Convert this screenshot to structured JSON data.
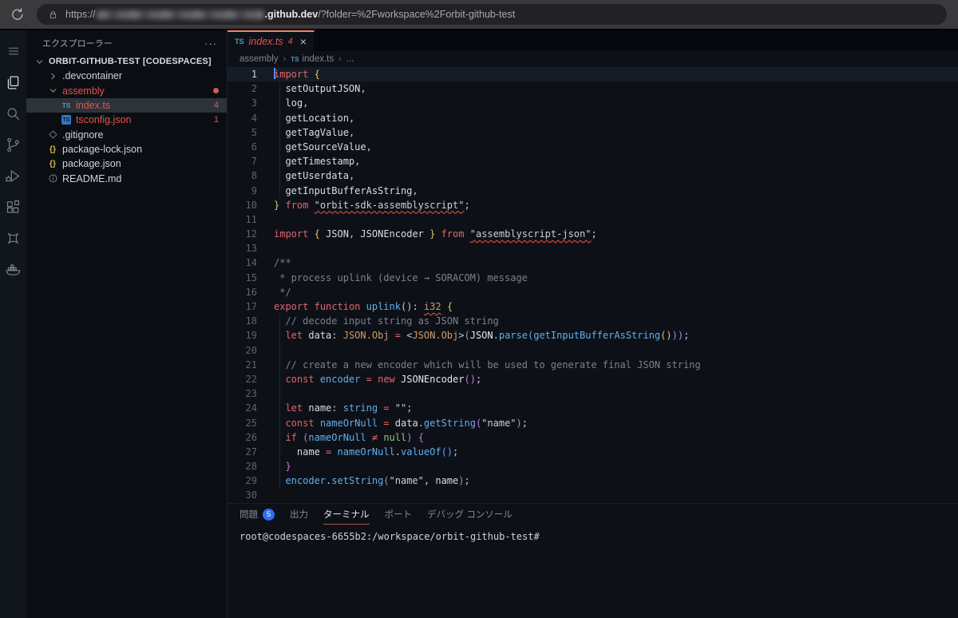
{
  "browser": {
    "url_scheme": "https://",
    "url_domain": ".github.dev",
    "url_path": "/?folder=%2Fworkspace%2Forbit-github-test"
  },
  "activity_bar": {
    "items": [
      {
        "name": "menu",
        "icon": "menu"
      },
      {
        "name": "explorer",
        "icon": "files",
        "active": true
      },
      {
        "name": "search",
        "icon": "search"
      },
      {
        "name": "source-control",
        "icon": "branch"
      },
      {
        "name": "run-debug",
        "icon": "debug"
      },
      {
        "name": "extensions",
        "icon": "extensions"
      },
      {
        "name": "codespaces",
        "icon": "codespaces"
      },
      {
        "name": "docker",
        "icon": "docker"
      }
    ]
  },
  "explorer": {
    "title": "エクスプローラー",
    "menu_icon": "···",
    "rows": [
      {
        "label": "ORBIT-GITHUB-TEST [CODESPACES]",
        "depth": 0,
        "chevron": "down",
        "bold": true
      },
      {
        "label": ".devcontainer",
        "depth": 1,
        "chevron": "right"
      },
      {
        "label": "assembly",
        "depth": 1,
        "chevron": "down",
        "error": true,
        "dot": true
      },
      {
        "label": "index.ts",
        "depth": 2,
        "icon": "ts",
        "error": true,
        "badge": "4",
        "selected": true
      },
      {
        "label": "tsconfig.json",
        "depth": 2,
        "icon": "tsbox",
        "error": true,
        "badge": "1"
      },
      {
        "label": ".gitignore",
        "depth": 1,
        "icon": "diamond"
      },
      {
        "label": "package-lock.json",
        "depth": 1,
        "icon": "braces"
      },
      {
        "label": "package.json",
        "depth": 1,
        "icon": "braces"
      },
      {
        "label": "README.md",
        "depth": 1,
        "icon": "info"
      }
    ]
  },
  "tabs": [
    {
      "icon_text": "TS",
      "label": "index.ts",
      "badge": "4",
      "close": "×",
      "active": true
    }
  ],
  "breadcrumbs": [
    {
      "label": "assembly"
    },
    {
      "label": "index.ts",
      "icon": "ts"
    },
    {
      "label": "..."
    }
  ],
  "editor": {
    "indent_guides": [
      [
        2,
        9
      ],
      [
        18,
        29
      ]
    ],
    "lines": [
      {
        "n": 1,
        "current": true,
        "cursor": true,
        "t": [
          [
            "kw",
            "import"
          ],
          [
            "p",
            " "
          ],
          [
            "b1",
            "{"
          ]
        ]
      },
      {
        "n": 2,
        "t": [
          [
            "p",
            "  "
          ],
          [
            "v",
            "setOutputJSON"
          ],
          [
            "p",
            ","
          ]
        ]
      },
      {
        "n": 3,
        "t": [
          [
            "p",
            "  "
          ],
          [
            "v",
            "log"
          ],
          [
            "p",
            ","
          ]
        ]
      },
      {
        "n": 4,
        "t": [
          [
            "p",
            "  "
          ],
          [
            "v",
            "getLocation"
          ],
          [
            "p",
            ","
          ]
        ]
      },
      {
        "n": 5,
        "t": [
          [
            "p",
            "  "
          ],
          [
            "v",
            "getTagValue"
          ],
          [
            "p",
            ","
          ]
        ]
      },
      {
        "n": 6,
        "t": [
          [
            "p",
            "  "
          ],
          [
            "v",
            "getSourceValue"
          ],
          [
            "p",
            ","
          ]
        ]
      },
      {
        "n": 7,
        "t": [
          [
            "p",
            "  "
          ],
          [
            "v",
            "getTimestamp"
          ],
          [
            "p",
            ","
          ]
        ]
      },
      {
        "n": 8,
        "t": [
          [
            "p",
            "  "
          ],
          [
            "v",
            "getUserdata"
          ],
          [
            "p",
            ","
          ]
        ]
      },
      {
        "n": 9,
        "t": [
          [
            "p",
            "  "
          ],
          [
            "v",
            "getInputBufferAsString"
          ],
          [
            "p",
            ","
          ]
        ]
      },
      {
        "n": 10,
        "t": [
          [
            "b1",
            "}"
          ],
          [
            "p",
            " "
          ],
          [
            "kw",
            "from"
          ],
          [
            "p",
            " "
          ],
          [
            "strE",
            "\"orbit-sdk-assemblyscript\""
          ],
          [
            "p",
            ";"
          ]
        ]
      },
      {
        "n": 11,
        "t": []
      },
      {
        "n": 12,
        "t": [
          [
            "kw",
            "import"
          ],
          [
            "p",
            " "
          ],
          [
            "b1",
            "{"
          ],
          [
            "p",
            " "
          ],
          [
            "v",
            "JSON"
          ],
          [
            "p",
            ", "
          ],
          [
            "v",
            "JSONEncoder"
          ],
          [
            "p",
            " "
          ],
          [
            "b1",
            "}"
          ],
          [
            "p",
            " "
          ],
          [
            "kw",
            "from"
          ],
          [
            "p",
            " "
          ],
          [
            "strE",
            "\"assemblyscript-json\""
          ],
          [
            "p",
            ";"
          ]
        ]
      },
      {
        "n": 13,
        "t": []
      },
      {
        "n": 14,
        "t": [
          [
            "cm",
            "/**"
          ]
        ]
      },
      {
        "n": 15,
        "t": [
          [
            "cm",
            " * process uplink (device → SORACOM) message"
          ]
        ]
      },
      {
        "n": 16,
        "t": [
          [
            "cm",
            " */"
          ]
        ]
      },
      {
        "n": 17,
        "t": [
          [
            "kw",
            "export"
          ],
          [
            "p",
            " "
          ],
          [
            "kw",
            "function"
          ],
          [
            "p",
            " "
          ],
          [
            "fn",
            "uplink"
          ],
          [
            "p",
            "()"
          ],
          [
            "p",
            ": "
          ],
          [
            "typE",
            "i32"
          ],
          [
            "p",
            " "
          ],
          [
            "b1",
            "{"
          ]
        ]
      },
      {
        "n": 18,
        "t": [
          [
            "p",
            "  "
          ],
          [
            "cm",
            "// decode input string as JSON string"
          ]
        ]
      },
      {
        "n": 19,
        "t": [
          [
            "p",
            "  "
          ],
          [
            "kw",
            "let"
          ],
          [
            "p",
            " "
          ],
          [
            "v",
            "data"
          ],
          [
            "p",
            ": "
          ],
          [
            "typ",
            "JSON.Obj"
          ],
          [
            "p",
            " "
          ],
          [
            "op",
            "="
          ],
          [
            "p",
            " <"
          ],
          [
            "typ",
            "JSON.Obj"
          ],
          [
            "p",
            ">"
          ],
          [
            "b2",
            "("
          ],
          [
            "wt",
            "JSON"
          ],
          [
            "p",
            "."
          ],
          [
            "fn",
            "parse"
          ],
          [
            "b3",
            "("
          ],
          [
            "fn",
            "getInputBufferAsString"
          ],
          [
            "b1",
            "()"
          ],
          [
            "b3",
            ")"
          ],
          [
            "b2",
            ")"
          ],
          [
            "p",
            ";"
          ]
        ]
      },
      {
        "n": 20,
        "t": []
      },
      {
        "n": 21,
        "t": [
          [
            "p",
            "  "
          ],
          [
            "cm",
            "// create a new encoder which will be used to generate final JSON string"
          ]
        ]
      },
      {
        "n": 22,
        "t": [
          [
            "p",
            "  "
          ],
          [
            "kw",
            "const"
          ],
          [
            "p",
            " "
          ],
          [
            "fn",
            "encoder"
          ],
          [
            "p",
            " "
          ],
          [
            "op",
            "="
          ],
          [
            "p",
            " "
          ],
          [
            "kw",
            "new"
          ],
          [
            "p",
            " "
          ],
          [
            "wt",
            "JSONEncoder"
          ],
          [
            "b2",
            "()"
          ],
          [
            "p",
            ";"
          ]
        ]
      },
      {
        "n": 23,
        "t": []
      },
      {
        "n": 24,
        "t": [
          [
            "p",
            "  "
          ],
          [
            "kw",
            "let"
          ],
          [
            "p",
            " "
          ],
          [
            "v",
            "name"
          ],
          [
            "p",
            ": "
          ],
          [
            "fn",
            "string"
          ],
          [
            "p",
            " "
          ],
          [
            "op",
            "="
          ],
          [
            "p",
            " "
          ],
          [
            "str",
            "\"\""
          ],
          [
            "p",
            ";"
          ]
        ]
      },
      {
        "n": 25,
        "t": [
          [
            "p",
            "  "
          ],
          [
            "kw",
            "const"
          ],
          [
            "p",
            " "
          ],
          [
            "fn",
            "nameOrNull"
          ],
          [
            "p",
            " "
          ],
          [
            "op",
            "="
          ],
          [
            "p",
            " "
          ],
          [
            "v",
            "data"
          ],
          [
            "p",
            "."
          ],
          [
            "fn",
            "getString"
          ],
          [
            "b2",
            "("
          ],
          [
            "str",
            "\"name\""
          ],
          [
            "b2",
            ")"
          ],
          [
            "p",
            ";"
          ]
        ]
      },
      {
        "n": 26,
        "t": [
          [
            "p",
            "  "
          ],
          [
            "kw",
            "if"
          ],
          [
            "p",
            " "
          ],
          [
            "b2",
            "("
          ],
          [
            "fn",
            "nameOrNull"
          ],
          [
            "p",
            " "
          ],
          [
            "op",
            "≠"
          ],
          [
            "p",
            " "
          ],
          [
            "nul",
            "null"
          ],
          [
            "b2",
            ")"
          ],
          [
            "p",
            " "
          ],
          [
            "b2",
            "{"
          ]
        ]
      },
      {
        "n": 27,
        "t": [
          [
            "p",
            "    "
          ],
          [
            "v",
            "name"
          ],
          [
            "p",
            " "
          ],
          [
            "op",
            "="
          ],
          [
            "p",
            " "
          ],
          [
            "fn",
            "nameOrNull"
          ],
          [
            "p",
            "."
          ],
          [
            "fn",
            "valueOf"
          ],
          [
            "b3",
            "()"
          ],
          [
            "p",
            ";"
          ]
        ]
      },
      {
        "n": 28,
        "t": [
          [
            "p",
            "  "
          ],
          [
            "b2",
            "}"
          ]
        ]
      },
      {
        "n": 29,
        "t": [
          [
            "p",
            "  "
          ],
          [
            "fn",
            "encoder"
          ],
          [
            "p",
            "."
          ],
          [
            "fn",
            "setString"
          ],
          [
            "b2",
            "("
          ],
          [
            "str",
            "\"name\""
          ],
          [
            "p",
            ", "
          ],
          [
            "v",
            "name"
          ],
          [
            "b2",
            ")"
          ],
          [
            "p",
            ";"
          ]
        ]
      },
      {
        "n": 30,
        "t": []
      }
    ]
  },
  "panel": {
    "tabs": [
      {
        "label": "問題",
        "badge": "5"
      },
      {
        "label": "出力"
      },
      {
        "label": "ターミナル",
        "active": true
      },
      {
        "label": "ポート"
      },
      {
        "label": "デバッグ コンソール"
      }
    ],
    "terminal_prompt": "root@codespaces-6655b2:/workspace/orbit-github-test#"
  },
  "colors": {
    "tab_accent": "#f78166",
    "error_red": "#e5534b",
    "problems_badge_blue": "#2f6feb",
    "cursor_blue": "#5290ff",
    "terminal_tab_underline": "#a9563f",
    "ts_icon_blue": "#519aba"
  }
}
